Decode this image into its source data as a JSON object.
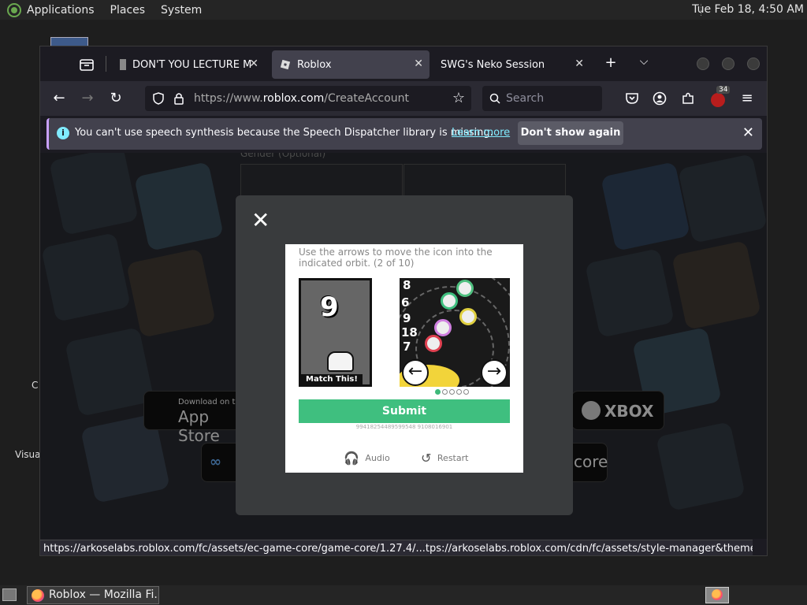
{
  "top_panel": {
    "menus": [
      "Applications",
      "Places",
      "System"
    ],
    "clock": "Tue Feb 18,  4:50 AM"
  },
  "desktop": {
    "label_c": "C",
    "label_visual": "Visua"
  },
  "browser": {
    "tabs": [
      {
        "title": "DON'T YOU LECTURE ME",
        "active": false
      },
      {
        "title": "Roblox",
        "active": true
      },
      {
        "title": "SWG's Neko Session",
        "active": false
      }
    ],
    "url_prefix": "https://www.",
    "url_domain": "roblox.com",
    "url_path": "/CreateAccount",
    "search_placeholder": "Search",
    "extensions_badge": "34",
    "notification": {
      "message": "You can't use speech synthesis because the Speech Dispatcher library is missing.",
      "learn_more": "Learn more",
      "dont_show": "Don't show again"
    },
    "status_url": "https://arkoselabs.roblox.com/fc/assets/ec-game-core/game-core/1.27.4/...tps://arkoselabs.roblox.com/cdn/fc/assets/style-manager&theme=default#"
  },
  "page": {
    "gender_label": "Gender (Optional)",
    "store_buttons": {
      "app_store_small": "Download on the",
      "app_store": "App Store",
      "xbox": "XBOX",
      "store": "core"
    }
  },
  "captcha": {
    "instruction": "Use the arrows to move the icon into the indicated orbit. (2 of 10)",
    "target_number": "9",
    "match_label": "Match This!",
    "orbit_numbers": [
      "8",
      "6",
      "9",
      "18",
      "7"
    ],
    "progress_total": 5,
    "progress_current": 1,
    "submit_label": "Submit",
    "session_id": "99418254489599548 9108016901",
    "audio_label": "Audio",
    "restart_label": "Restart"
  },
  "taskbar": {
    "task_title": "Roblox — Mozilla Fi..."
  },
  "colors": {
    "submit": "#3fbf7f",
    "info": "#80ebff"
  }
}
